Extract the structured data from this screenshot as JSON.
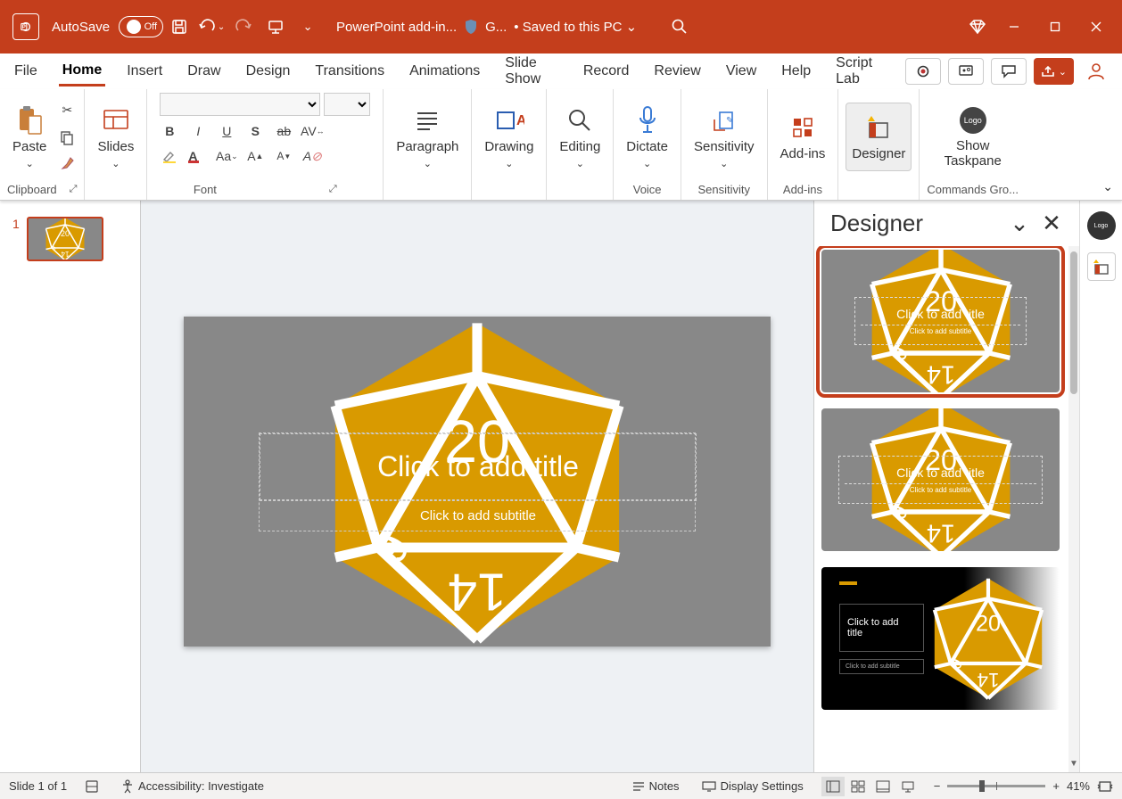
{
  "titlebar": {
    "autosave_label": "AutoSave",
    "autosave_state": "Off",
    "doc_status": "PowerPoint add-in...",
    "guard": "G...",
    "saved": "Saved to this PC"
  },
  "tabs": {
    "items": [
      "File",
      "Home",
      "Insert",
      "Draw",
      "Design",
      "Transitions",
      "Animations",
      "Slide Show",
      "Record",
      "Review",
      "View",
      "Help",
      "Script Lab"
    ],
    "active_index": 1
  },
  "ribbon": {
    "clipboard": {
      "paste": "Paste",
      "label": "Clipboard"
    },
    "slides": {
      "slides": "Slides"
    },
    "font": {
      "label": "Font"
    },
    "paragraph": {
      "label": "Paragraph"
    },
    "drawing": {
      "label": "Drawing"
    },
    "editing": {
      "label": "Editing"
    },
    "dictate": {
      "label_btn": "Dictate",
      "label": "Voice"
    },
    "sensitivity": {
      "label_btn": "Sensitivity",
      "label": "Sensitivity"
    },
    "addins": {
      "label_btn": "Add-ins",
      "label": "Add-ins"
    },
    "designer": {
      "label_btn": "Designer"
    },
    "taskpane": {
      "label_btn": "Show Taskpane",
      "label": "Commands Gro..."
    }
  },
  "thumbs": {
    "slide_number": "1"
  },
  "slide": {
    "title_placeholder": "Click to add title",
    "subtitle_placeholder": "Click to add subtitle",
    "dice_value": "20"
  },
  "designer_pane": {
    "title": "Designer",
    "suggestions": [
      {
        "title": "Click to add title",
        "subtitle": "Click to add subtitle",
        "dice": "20"
      },
      {
        "title": "Click to add title",
        "subtitle": "Click to add subtitle",
        "dice": "20"
      },
      {
        "title": "Click to add title",
        "subtitle": "Click to add subtitle",
        "dice": "20"
      }
    ]
  },
  "status": {
    "slide_info": "Slide 1 of 1",
    "accessibility": "Accessibility: Investigate",
    "notes": "Notes",
    "display": "Display Settings",
    "zoom": "41%"
  },
  "colors": {
    "accent": "#C43E1C",
    "dice": "#d99a00"
  }
}
